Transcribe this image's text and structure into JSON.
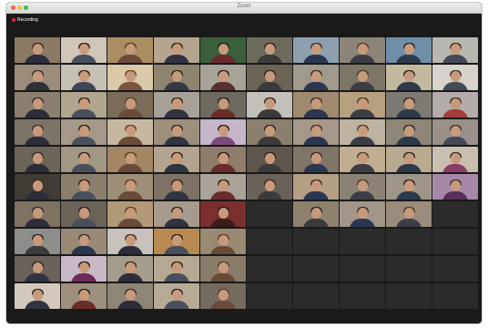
{
  "window": {
    "title": "Zoom",
    "recording_label": "Recording"
  },
  "gallery": {
    "columns": 10,
    "rows": 10,
    "video_tiles": [
      {
        "bg": "#8a7a63",
        "body": "#2e2e3a",
        "hair": "#3a2a20"
      },
      {
        "bg": "#cfc6b8",
        "body": "#4a4f5c",
        "hair": "#2a1f18"
      },
      {
        "bg": "#a98e63",
        "body": "#6a4b3a",
        "hair": "#5a3a22"
      },
      {
        "bg": "#b4a58f",
        "body": "#2f3440",
        "hair": "#2b2219"
      },
      {
        "bg": "#3a5f3a",
        "body": "#6b2b2b",
        "hair": "#1e1a18"
      },
      {
        "bg": "#6d6b5c",
        "body": "#3b3b3b",
        "hair": "#2a2420"
      },
      {
        "bg": "#8da0b0",
        "body": "#2b3650",
        "hair": "#3b2c22"
      },
      {
        "bg": "#8c8478",
        "body": "#3d3d47",
        "hair": "#4a3828"
      },
      {
        "bg": "#6f8fa9",
        "body": "#2d3a4a",
        "hair": "#2a211b"
      },
      {
        "bg": "#b9b7b2",
        "body": "#444a55",
        "hair": "#3b2e24"
      },
      {
        "bg": "#9b8c7c",
        "body": "#2f2f38",
        "hair": "#3a2a20"
      },
      {
        "bg": "#c7c0b4",
        "body": "#3f465a",
        "hair": "#2a1f18"
      },
      {
        "bg": "#d9c9a9",
        "body": "#7a5540",
        "hair": "#6a4428"
      },
      {
        "bg": "#8e8470",
        "body": "#353a45",
        "hair": "#2b2219"
      },
      {
        "bg": "#a7a399",
        "body": "#5a3030",
        "hair": "#1e1a18"
      },
      {
        "bg": "#6a6356",
        "body": "#3b3b3b",
        "hair": "#2a2420"
      },
      {
        "bg": "#a09a8c",
        "body": "#2b3650",
        "hair": "#3b2c22"
      },
      {
        "bg": "#7d7566",
        "body": "#3d3d47",
        "hair": "#4a3828"
      },
      {
        "bg": "#c2b99f",
        "body": "#2d3a4a",
        "hair": "#2a211b"
      },
      {
        "bg": "#d7d3cc",
        "body": "#444a55",
        "hair": "#3b2e24"
      },
      {
        "bg": "#8a7f70",
        "body": "#2e2e3a",
        "hair": "#3a2a20"
      },
      {
        "bg": "#b0a690",
        "body": "#4a4f5c",
        "hair": "#2a1f18"
      },
      {
        "bg": "#7b6c58",
        "body": "#6a4b3a",
        "hair": "#5a3a22"
      },
      {
        "bg": "#a8a19a",
        "body": "#2f3440",
        "hair": "#2b2219"
      },
      {
        "bg": "#6f6a60",
        "body": "#6b2b2b",
        "hair": "#1e1a18"
      },
      {
        "bg": "#c4c1bb",
        "body": "#3b3b3b",
        "hair": "#2a2420"
      },
      {
        "bg": "#9f8a6f",
        "body": "#2b3650",
        "hair": "#3b2c22"
      },
      {
        "bg": "#b7a07f",
        "body": "#3d3d47",
        "hair": "#4a3828"
      },
      {
        "bg": "#7e7a73",
        "body": "#2d3a4a",
        "hair": "#2a211b"
      },
      {
        "bg": "#b3acaa",
        "body": "#a33c3c",
        "hair": "#3b2e24"
      },
      {
        "bg": "#7c7468",
        "body": "#2e2e3a",
        "hair": "#3a2a20"
      },
      {
        "bg": "#a69888",
        "body": "#4a4f5c",
        "hair": "#2a1f18"
      },
      {
        "bg": "#c6b8a0",
        "body": "#6a4b3a",
        "hair": "#5a3a22"
      },
      {
        "bg": "#9c8f7c",
        "body": "#2f3440",
        "hair": "#2b2219"
      },
      {
        "bg": "#c5b7c9",
        "body": "#7a4a7a",
        "hair": "#1e1a18"
      },
      {
        "bg": "#8c7f6d",
        "body": "#3b3b3b",
        "hair": "#2a2420"
      },
      {
        "bg": "#a5988a",
        "body": "#2b3650",
        "hair": "#3b2c22"
      },
      {
        "bg": "#bdb3a1",
        "body": "#3d3d47",
        "hair": "#4a3828"
      },
      {
        "bg": "#8e8678",
        "body": "#2d3a4a",
        "hair": "#2a211b"
      },
      {
        "bg": "#9a918a",
        "body": "#444a55",
        "hair": "#3b2e24"
      },
      {
        "bg": "#6d6559",
        "body": "#2e2e3a",
        "hair": "#3a2a20"
      },
      {
        "bg": "#a29784",
        "body": "#4a4f5c",
        "hair": "#2a1f18"
      },
      {
        "bg": "#a38664",
        "body": "#6a4b3a",
        "hair": "#5a3a22"
      },
      {
        "bg": "#b2a48f",
        "body": "#2f3440",
        "hair": "#2b2219"
      },
      {
        "bg": "#8f7c6a",
        "body": "#6b2b2b",
        "hair": "#1e1a18"
      },
      {
        "bg": "#5e564d",
        "body": "#3b3b3b",
        "hair": "#2a2420"
      },
      {
        "bg": "#807668",
        "body": "#2b3650",
        "hair": "#3b2c22"
      },
      {
        "bg": "#bfae92",
        "body": "#3d3d47",
        "hair": "#4a3828"
      },
      {
        "bg": "#b8a991",
        "body": "#2d3a4a",
        "hair": "#2a211b"
      },
      {
        "bg": "#c9bfb0",
        "body": "#8a3d6a",
        "hair": "#3b2e24"
      },
      {
        "bg": "#403b35",
        "body": "#2e2e3a",
        "hair": "#3a2a20"
      },
      {
        "bg": "#8a7e6d",
        "body": "#4a4f5c",
        "hair": "#2a1f18"
      },
      {
        "bg": "#9c8e77",
        "body": "#6a4b3a",
        "hair": "#5a3a22"
      },
      {
        "bg": "#7d7265",
        "body": "#2f3440",
        "hair": "#2b2219"
      },
      {
        "bg": "#a9a39a",
        "body": "#6b2b2b",
        "hair": "#1e1a18"
      },
      {
        "bg": "#6a6258",
        "body": "#3b3b3b",
        "hair": "#2a2420"
      },
      {
        "bg": "#b49f84",
        "body": "#2b3650",
        "hair": "#3b2c22"
      },
      {
        "bg": "#8b8275",
        "body": "#3d3d47",
        "hair": "#4a3828"
      },
      {
        "bg": "#9f968a",
        "body": "#2d3a4a",
        "hair": "#2a211b"
      },
      {
        "bg": "#a58aa8",
        "body": "#5a2d5a",
        "hair": "#3b2e24"
      },
      {
        "bg": "#7e7263",
        "body": "#2e2e3a",
        "hair": "#3a2a20"
      },
      {
        "bg": "#6b6357",
        "body": "#4a4f5c",
        "hair": "#2a1f18"
      },
      {
        "bg": "#b19978",
        "body": "#6a4b3a",
        "hair": "#5a3a22"
      },
      {
        "bg": "#a69b8c",
        "body": "#2f3440",
        "hair": "#2b2219"
      },
      {
        "bg": "#7a2e2e",
        "body": "#3a1c1c",
        "hair": "#1e1a18"
      },
      {
        "bg": "#8d8d8a",
        "body": "#3b3b3b",
        "hair": "#2a2420"
      },
      {
        "bg": "#988a77",
        "body": "#2b3650",
        "hair": "#3b2c22"
      },
      {
        "bg": "#c7c3bc",
        "body": "#2e2e3a",
        "hair": "#3a2a20"
      },
      {
        "bg": "#b88a52",
        "body": "#4a4f5c",
        "hair": "#2a1f18"
      },
      {
        "bg": "#9b8a73",
        "body": "#6a4b3a",
        "hair": "#5a3a22"
      },
      {
        "bg": "#6a625a",
        "body": "#2f3440",
        "hair": "#2b2219"
      },
      {
        "bg": "#c9b9c6",
        "body": "#6b2b5b",
        "hair": "#1e1a18"
      },
      {
        "bg": "#a69c8c",
        "body": "#2e2e3a",
        "hair": "#3a2a20"
      },
      {
        "bg": "#b5a994",
        "body": "#4a4f5c",
        "hair": "#2a1f18"
      },
      {
        "bg": "#8a7c6a",
        "body": "#6a4b3a",
        "hair": "#5a3a22"
      },
      {
        "bg": "#d2c9bc",
        "body": "#2f3440",
        "hair": "#2b2219"
      },
      {
        "bg": "#9e907e",
        "body": "#6b2b2b",
        "hair": "#1e1a18"
      },
      {
        "bg": "#8f8577",
        "body": "#2e2e3a",
        "hair": "#3a2a20"
      },
      {
        "bg": "#b7ab98",
        "body": "#4a4f5c",
        "hair": "#2a1f18"
      },
      {
        "bg": "#746a5e",
        "body": "#6a4b3a",
        "hair": "#5a3a22"
      },
      {
        "bg": "#a49b90",
        "body": "#2f3440",
        "hair": "#2b2219"
      },
      {
        "bg": "#8c8275",
        "body": "#6b2b2b",
        "hair": "#1e1a18"
      }
    ],
    "name_tiles": [
      {
        "label": "",
        "row": 7,
        "col": 6
      },
      {
        "label": "",
        "row": 7,
        "col": 10
      },
      {
        "label": "",
        "row": 8,
        "col": 6
      },
      {
        "label": "",
        "row": 8,
        "col": 7
      },
      {
        "label": "",
        "row": 8,
        "col": 8
      },
      {
        "label": "",
        "row": 8,
        "col": 9
      },
      {
        "label": "",
        "row": 8,
        "col": 10
      },
      {
        "label": "",
        "row": 9,
        "col": 6
      },
      {
        "label": "",
        "row": 9,
        "col": 7
      },
      {
        "label": "",
        "row": 9,
        "col": 8
      },
      {
        "label": "",
        "row": 9,
        "col": 9
      },
      {
        "label": "",
        "row": 9,
        "col": 10
      },
      {
        "label": "",
        "row": 10,
        "col": 6
      },
      {
        "label": "",
        "row": 10,
        "col": 7
      },
      {
        "label": "",
        "row": 10,
        "col": 8
      },
      {
        "label": "",
        "row": 10,
        "col": 9
      },
      {
        "label": "",
        "row": 10,
        "col": 10
      }
    ],
    "video_tiles_late": [
      {
        "row": 7,
        "col": 7,
        "bg": "#8d8270",
        "body": "#3b3b3b",
        "hair": "#2a2420"
      },
      {
        "row": 7,
        "col": 8,
        "bg": "#a2968a",
        "body": "#2b3650",
        "hair": "#3b2c22"
      },
      {
        "row": 7,
        "col": 9,
        "bg": "#9a8d7c",
        "body": "#3d3d47",
        "hair": "#4a3828"
      }
    ]
  }
}
